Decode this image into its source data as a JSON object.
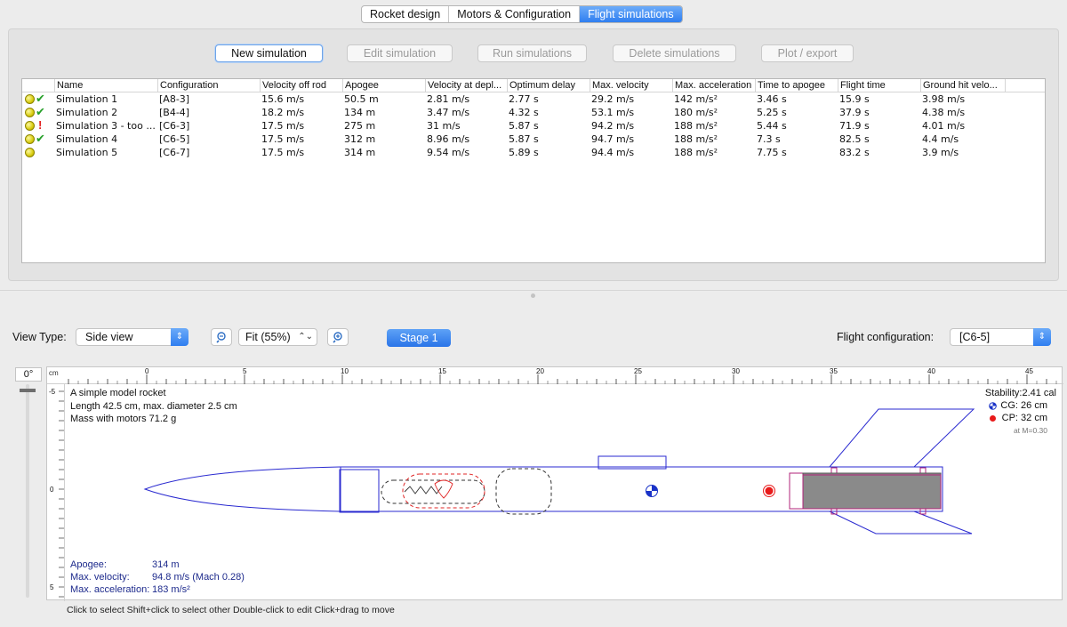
{
  "tabs": [
    {
      "label": "Rocket design",
      "active": false
    },
    {
      "label": "Motors & Configuration",
      "active": false
    },
    {
      "label": "Flight simulations",
      "active": true
    }
  ],
  "sim_buttons": {
    "new": "New simulation",
    "edit": "Edit simulation",
    "run": "Run simulations",
    "delete": "Delete simulations",
    "plot": "Plot / export"
  },
  "table": {
    "columns": [
      "Name",
      "Configuration",
      "Velocity off rod",
      "Apogee",
      "Velocity at depl...",
      "Optimum delay",
      "Max. velocity",
      "Max. acceleration",
      "Time to apogee",
      "Flight time",
      "Ground hit velo..."
    ],
    "rows": [
      {
        "status": "ok",
        "cells": [
          "Simulation 1",
          "[A8-3]",
          "15.6 m/s",
          "50.5 m",
          "2.81 m/s",
          "2.77 s",
          "29.2 m/s",
          "142 m/s²",
          "3.46 s",
          "15.9 s",
          "3.98 m/s"
        ]
      },
      {
        "status": "ok",
        "cells": [
          "Simulation 2",
          "[B4-4]",
          "18.2 m/s",
          "134 m",
          "3.47 m/s",
          "4.32 s",
          "53.1 m/s",
          "180 m/s²",
          "5.25 s",
          "37.9 s",
          "4.38 m/s"
        ]
      },
      {
        "status": "warn",
        "cells": [
          "Simulation 3 - too ...",
          "[C6-3]",
          "17.5 m/s",
          "275 m",
          "31 m/s",
          "5.87 s",
          "94.2 m/s",
          "188 m/s²",
          "5.44 s",
          "71.9 s",
          "4.01 m/s"
        ]
      },
      {
        "status": "ok",
        "cells": [
          "Simulation 4",
          "[C6-5]",
          "17.5 m/s",
          "312 m",
          "8.96 m/s",
          "5.87 s",
          "94.7 m/s",
          "188 m/s²",
          "7.3 s",
          "82.5 s",
          "4.4 m/s"
        ]
      },
      {
        "status": "ok",
        "cells": [
          "Simulation 5",
          "[C6-7]",
          "17.5 m/s",
          "314 m",
          "9.54 m/s",
          "5.89 s",
          "94.4 m/s",
          "188 m/s²",
          "7.75 s",
          "83.2 s",
          "3.9 m/s"
        ]
      }
    ]
  },
  "viewbar": {
    "view_type_label": "View Type:",
    "view_type_value": "Side view",
    "zoom_value": "Fit (55%)",
    "stage_button": "Stage 1",
    "flight_config_label": "Flight configuration:",
    "flight_config_value": "[C6-5]",
    "angle": "0°"
  },
  "ruler": {
    "unit": "cm",
    "labels": [
      "0",
      "5",
      "10",
      "15",
      "20",
      "25",
      "30",
      "35",
      "40",
      "45"
    ],
    "v_labels": [
      "-5",
      "0",
      "5"
    ]
  },
  "rocket_info": {
    "name": "A simple model rocket",
    "length_line": "Length 42.5 cm, max. diameter 2.5 cm",
    "mass_line": "Mass with motors 71.2 g",
    "stability": "Stability:2.41 cal",
    "cg": "CG:  26 cm",
    "cp": "CP:  32 cm",
    "mach": "at M=0.30"
  },
  "flight_info": {
    "apogee_label": "Apogee:",
    "apogee_value": "314 m",
    "maxv_label": "Max. velocity:",
    "maxv_value": "94.8 m/s  (Mach 0.28)",
    "maxa_label": "Max. acceleration:",
    "maxa_value": "183 m/s²"
  },
  "status_hint": "Click to select    Shift+click to select other    Double-click to edit    Click+drag to move",
  "colors": {
    "accent": "#2f7ef0",
    "outline": "#2a2ad0",
    "motor": "#8a8a8a",
    "ok": "#27a02a",
    "warn": "#e21f1f"
  }
}
